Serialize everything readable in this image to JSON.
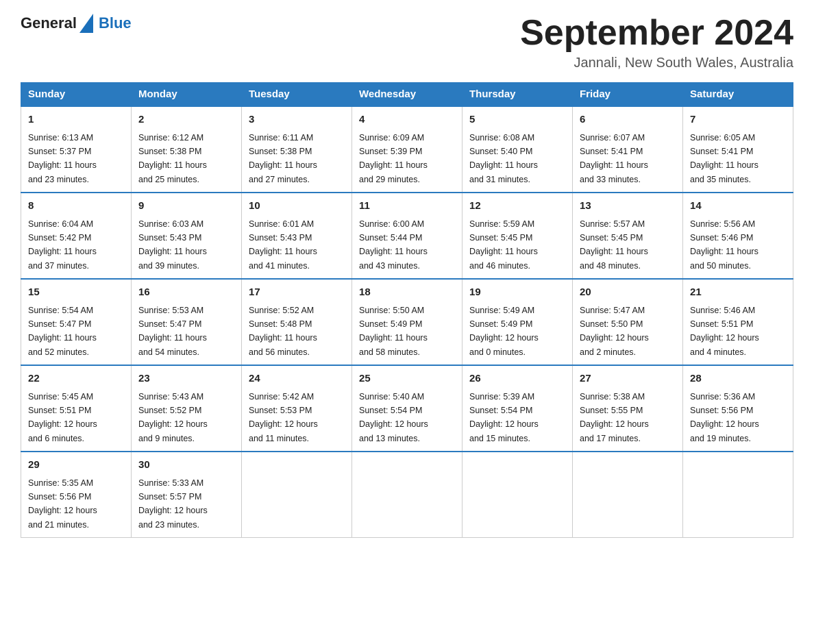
{
  "header": {
    "logo_general": "General",
    "logo_blue": "Blue",
    "title": "September 2024",
    "location": "Jannali, New South Wales, Australia"
  },
  "days_of_week": [
    "Sunday",
    "Monday",
    "Tuesday",
    "Wednesday",
    "Thursday",
    "Friday",
    "Saturday"
  ],
  "weeks": [
    [
      {
        "day": "1",
        "sunrise": "6:13 AM",
        "sunset": "5:37 PM",
        "daylight": "11 hours and 23 minutes."
      },
      {
        "day": "2",
        "sunrise": "6:12 AM",
        "sunset": "5:38 PM",
        "daylight": "11 hours and 25 minutes."
      },
      {
        "day": "3",
        "sunrise": "6:11 AM",
        "sunset": "5:38 PM",
        "daylight": "11 hours and 27 minutes."
      },
      {
        "day": "4",
        "sunrise": "6:09 AM",
        "sunset": "5:39 PM",
        "daylight": "11 hours and 29 minutes."
      },
      {
        "day": "5",
        "sunrise": "6:08 AM",
        "sunset": "5:40 PM",
        "daylight": "11 hours and 31 minutes."
      },
      {
        "day": "6",
        "sunrise": "6:07 AM",
        "sunset": "5:41 PM",
        "daylight": "11 hours and 33 minutes."
      },
      {
        "day": "7",
        "sunrise": "6:05 AM",
        "sunset": "5:41 PM",
        "daylight": "11 hours and 35 minutes."
      }
    ],
    [
      {
        "day": "8",
        "sunrise": "6:04 AM",
        "sunset": "5:42 PM",
        "daylight": "11 hours and 37 minutes."
      },
      {
        "day": "9",
        "sunrise": "6:03 AM",
        "sunset": "5:43 PM",
        "daylight": "11 hours and 39 minutes."
      },
      {
        "day": "10",
        "sunrise": "6:01 AM",
        "sunset": "5:43 PM",
        "daylight": "11 hours and 41 minutes."
      },
      {
        "day": "11",
        "sunrise": "6:00 AM",
        "sunset": "5:44 PM",
        "daylight": "11 hours and 43 minutes."
      },
      {
        "day": "12",
        "sunrise": "5:59 AM",
        "sunset": "5:45 PM",
        "daylight": "11 hours and 46 minutes."
      },
      {
        "day": "13",
        "sunrise": "5:57 AM",
        "sunset": "5:45 PM",
        "daylight": "11 hours and 48 minutes."
      },
      {
        "day": "14",
        "sunrise": "5:56 AM",
        "sunset": "5:46 PM",
        "daylight": "11 hours and 50 minutes."
      }
    ],
    [
      {
        "day": "15",
        "sunrise": "5:54 AM",
        "sunset": "5:47 PM",
        "daylight": "11 hours and 52 minutes."
      },
      {
        "day": "16",
        "sunrise": "5:53 AM",
        "sunset": "5:47 PM",
        "daylight": "11 hours and 54 minutes."
      },
      {
        "day": "17",
        "sunrise": "5:52 AM",
        "sunset": "5:48 PM",
        "daylight": "11 hours and 56 minutes."
      },
      {
        "day": "18",
        "sunrise": "5:50 AM",
        "sunset": "5:49 PM",
        "daylight": "11 hours and 58 minutes."
      },
      {
        "day": "19",
        "sunrise": "5:49 AM",
        "sunset": "5:49 PM",
        "daylight": "12 hours and 0 minutes."
      },
      {
        "day": "20",
        "sunrise": "5:47 AM",
        "sunset": "5:50 PM",
        "daylight": "12 hours and 2 minutes."
      },
      {
        "day": "21",
        "sunrise": "5:46 AM",
        "sunset": "5:51 PM",
        "daylight": "12 hours and 4 minutes."
      }
    ],
    [
      {
        "day": "22",
        "sunrise": "5:45 AM",
        "sunset": "5:51 PM",
        "daylight": "12 hours and 6 minutes."
      },
      {
        "day": "23",
        "sunrise": "5:43 AM",
        "sunset": "5:52 PM",
        "daylight": "12 hours and 9 minutes."
      },
      {
        "day": "24",
        "sunrise": "5:42 AM",
        "sunset": "5:53 PM",
        "daylight": "12 hours and 11 minutes."
      },
      {
        "day": "25",
        "sunrise": "5:40 AM",
        "sunset": "5:54 PM",
        "daylight": "12 hours and 13 minutes."
      },
      {
        "day": "26",
        "sunrise": "5:39 AM",
        "sunset": "5:54 PM",
        "daylight": "12 hours and 15 minutes."
      },
      {
        "day": "27",
        "sunrise": "5:38 AM",
        "sunset": "5:55 PM",
        "daylight": "12 hours and 17 minutes."
      },
      {
        "day": "28",
        "sunrise": "5:36 AM",
        "sunset": "5:56 PM",
        "daylight": "12 hours and 19 minutes."
      }
    ],
    [
      {
        "day": "29",
        "sunrise": "5:35 AM",
        "sunset": "5:56 PM",
        "daylight": "12 hours and 21 minutes."
      },
      {
        "day": "30",
        "sunrise": "5:33 AM",
        "sunset": "5:57 PM",
        "daylight": "12 hours and 23 minutes."
      },
      null,
      null,
      null,
      null,
      null
    ]
  ],
  "labels": {
    "sunrise": "Sunrise:",
    "sunset": "Sunset:",
    "daylight": "Daylight:"
  }
}
